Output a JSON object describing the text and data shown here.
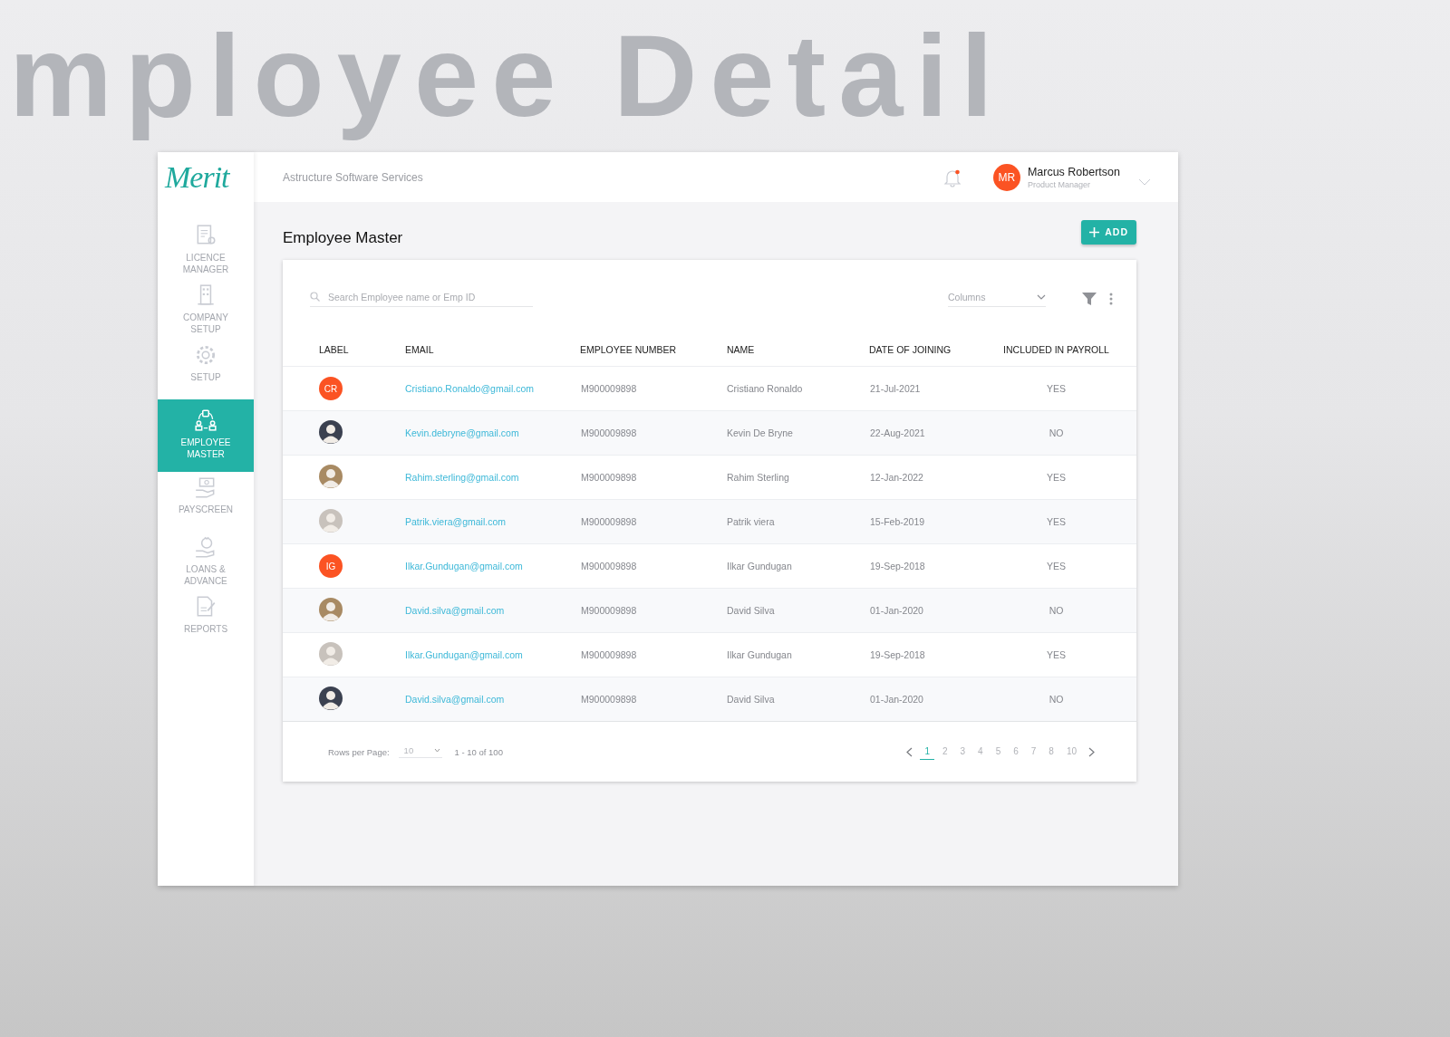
{
  "backdrop_title": "mployee Detail",
  "logo": "Merit",
  "company": "Astructure Software Services",
  "notifications": {
    "unread": true
  },
  "user": {
    "initials": "MR",
    "name": "Marcus Robertson",
    "role": "Product Manager"
  },
  "sidebar": {
    "items": [
      {
        "label": "LICENCE MANAGER",
        "kind": "licence",
        "selected": false
      },
      {
        "label": "COMPANY SETUP",
        "kind": "building",
        "selected": false
      },
      {
        "label": "SETUP",
        "kind": "gear",
        "selected": false
      },
      {
        "label": "EMPLOYEE MASTER",
        "kind": "people",
        "selected": true
      },
      {
        "label": "PAYSCREEN",
        "kind": "pay",
        "selected": false
      },
      {
        "label": "LOANS & ADVANCE",
        "kind": "loan",
        "selected": false
      },
      {
        "label": "REPORTS",
        "kind": "report",
        "selected": false
      }
    ]
  },
  "page_title": "Employee Master",
  "add_button": "ADD",
  "search": {
    "placeholder": "Search Employee name or Emp ID"
  },
  "columns_select": {
    "placeholder": "Columns"
  },
  "table": {
    "columns": [
      "LABEL",
      "EMAIL",
      "EMPLOYEE NUMBER",
      "NAME",
      "DATE OF JOINING",
      "INCLUDED IN PAYROLL"
    ],
    "rows": [
      {
        "avatar": {
          "kind": "initials",
          "text": "CR"
        },
        "email": "Cristiano.Ronaldo@gmail.com",
        "number": "M900009898",
        "name": "Cristiano Ronaldo",
        "joined": "21-Jul-2021",
        "payroll": "YES"
      },
      {
        "avatar": {
          "kind": "photo"
        },
        "email": "Kevin.debryne@gmail.com",
        "number": "M900009898",
        "name": "Kevin De Bryne",
        "joined": "22-Aug-2021",
        "payroll": "NO"
      },
      {
        "avatar": {
          "kind": "photo"
        },
        "email": "Rahim.sterling@gmail.com",
        "number": "M900009898",
        "name": "Rahim Sterling",
        "joined": "12-Jan-2022",
        "payroll": "YES"
      },
      {
        "avatar": {
          "kind": "photo"
        },
        "email": "Patrik.viera@gmail.com",
        "number": "M900009898",
        "name": "Patrik viera",
        "joined": "15-Feb-2019",
        "payroll": "YES"
      },
      {
        "avatar": {
          "kind": "initials",
          "text": "IG"
        },
        "email": "Ilkar.Gundugan@gmail.com",
        "number": "M900009898",
        "name": "Ilkar Gundugan",
        "joined": "19-Sep-2018",
        "payroll": "YES"
      },
      {
        "avatar": {
          "kind": "photo"
        },
        "email": "David.silva@gmail.com",
        "number": "M900009898",
        "name": "David Silva",
        "joined": "01-Jan-2020",
        "payroll": "NO"
      },
      {
        "avatar": {
          "kind": "photo"
        },
        "email": "Ilkar.Gundugan@gmail.com",
        "number": "M900009898",
        "name": "Ilkar Gundugan",
        "joined": "19-Sep-2018",
        "payroll": "YES"
      },
      {
        "avatar": {
          "kind": "photo"
        },
        "email": "David.silva@gmail.com",
        "number": "M900009898",
        "name": "David Silva",
        "joined": "01-Jan-2020",
        "payroll": "NO"
      }
    ]
  },
  "pagination": {
    "rows_per_page_label": "Rows per Page:",
    "rows_per_page": "10",
    "range": "1 - 10 of 100",
    "pages": [
      {
        "label": "1",
        "selected": true
      },
      {
        "label": "2",
        "selected": false
      },
      {
        "label": "3",
        "selected": false
      },
      {
        "label": "4",
        "selected": false
      },
      {
        "label": "5",
        "selected": false
      },
      {
        "label": "6",
        "selected": false
      },
      {
        "label": "7",
        "selected": false
      },
      {
        "label": "8",
        "selected": false
      },
      {
        "label": "10",
        "selected": false
      }
    ]
  }
}
